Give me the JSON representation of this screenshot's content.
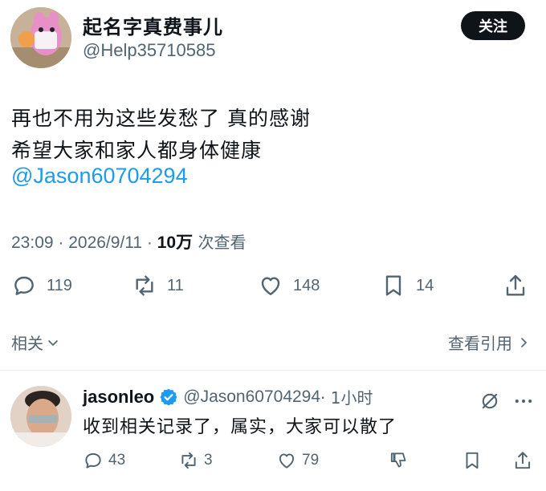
{
  "author": {
    "name": "起名字真费事儿",
    "handle": "@Help35710585",
    "follow_label": "关注"
  },
  "tweet": {
    "line1": "再也不用为这些发愁了 真的感谢",
    "line2": "希望大家和家人都身体健康",
    "mention": "@Jason60704294",
    "time": "23:09 · 2026/9/11 · ",
    "views_count": "10万",
    "views_label": " 次查看"
  },
  "actions": {
    "replies": "119",
    "retweets": "11",
    "likes": "148",
    "bookmarks": "14"
  },
  "related_label": "相关",
  "quotes_label": "查看引用",
  "reply": {
    "name": "jasonleo",
    "handle": "@Jason60704294",
    "time": " · 1小时",
    "text": "收到相关记录了，属实，大家可以散了",
    "replies": "43",
    "retweets": "3",
    "likes": "79"
  },
  "icons": [
    "reply-icon",
    "retweet-icon",
    "like-icon",
    "bookmark-icon",
    "share-icon",
    "verified-icon",
    "grok-icon",
    "more-icon",
    "dislike-icon",
    "chevron-down-icon",
    "chevron-right-icon"
  ],
  "colors": {
    "link": "#1d9bf0",
    "secondary": "#536471",
    "text": "#0f1419"
  }
}
